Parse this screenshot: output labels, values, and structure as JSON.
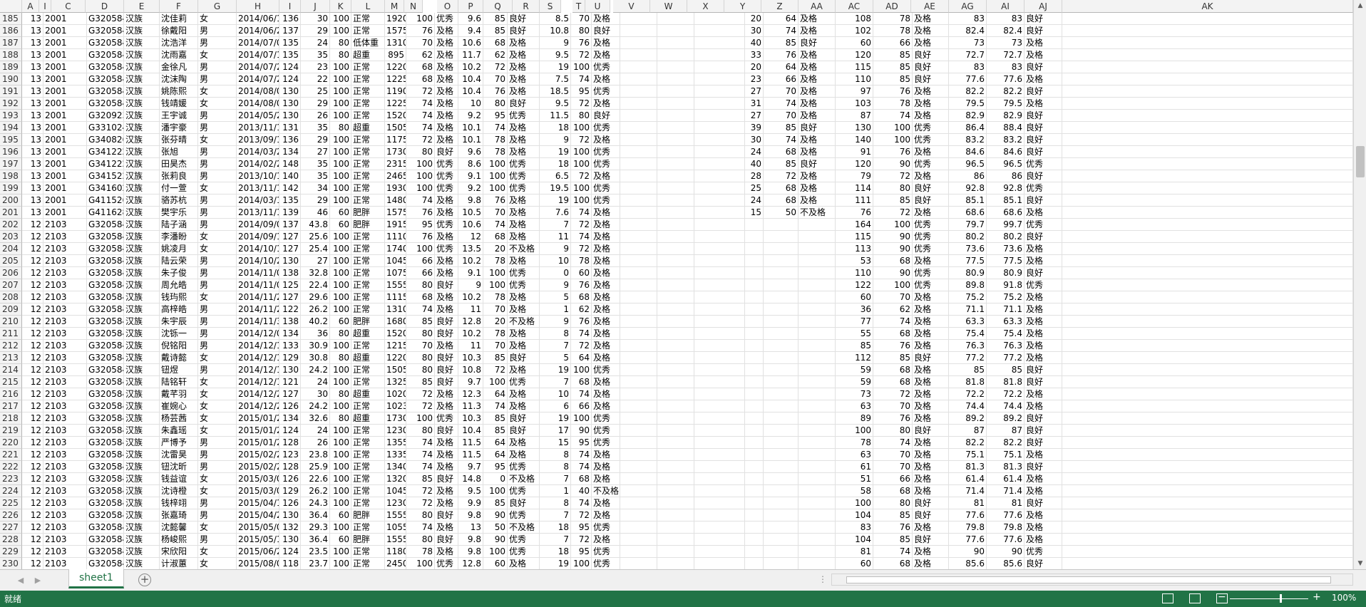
{
  "columns": [
    "A",
    "I",
    "C",
    "D",
    "E",
    "F",
    "G",
    "H",
    "I",
    "J",
    "K",
    "L",
    "M",
    "N",
    "O",
    "P",
    "Q",
    "R",
    "S",
    "T",
    "U",
    "V",
    "W",
    "X",
    "Y",
    "Z",
    "AA",
    "AC",
    "AD",
    "AE",
    "AG",
    "AI",
    "AJ",
    "AK"
  ],
  "rows": [
    [
      "185",
      "13",
      "2001",
      "G3205842",
      "汉族",
      "沈佳莉",
      "女",
      "2014/06/17",
      "136",
      "30",
      "100",
      "正常",
      "1920",
      "100",
      "优秀",
      "9.6",
      "85",
      "良好",
      "8.5",
      "70",
      "及格",
      "20",
      "64",
      "及格",
      "108",
      "78",
      "及格",
      "83",
      "83",
      "良好"
    ],
    [
      "186",
      "13",
      "2001",
      "G3205842",
      "汉族",
      "徐戴阳",
      "男",
      "2014/06/23",
      "137",
      "29",
      "100",
      "正常",
      "1575",
      "76",
      "及格",
      "9.4",
      "85",
      "良好",
      "10.8",
      "80",
      "良好",
      "30",
      "74",
      "及格",
      "102",
      "78",
      "及格",
      "82.4",
      "82.4",
      "良好"
    ],
    [
      "187",
      "13",
      "2001",
      "G3205842",
      "汉族",
      "沈浩洋",
      "男",
      "2014/07/06",
      "135",
      "24",
      "80",
      "低体重",
      "1310",
      "70",
      "及格",
      "10.6",
      "68",
      "及格",
      "9",
      "76",
      "及格",
      "40",
      "85",
      "良好",
      "60",
      "66",
      "及格",
      "73",
      "73",
      "及格"
    ],
    [
      "188",
      "13",
      "2001",
      "G3205842",
      "汉族",
      "沈雨嘉",
      "女",
      "2014/07/13",
      "135",
      "35",
      "80",
      "超重",
      "895",
      "62",
      "及格",
      "11.7",
      "62",
      "及格",
      "9.5",
      "72",
      "及格",
      "33",
      "76",
      "及格",
      "120",
      "85",
      "良好",
      "72.7",
      "72.7",
      "及格"
    ],
    [
      "189",
      "13",
      "2001",
      "G3205842",
      "汉族",
      "金徐凡",
      "男",
      "2014/07/22",
      "124",
      "23",
      "100",
      "正常",
      "1220",
      "68",
      "及格",
      "10.2",
      "72",
      "及格",
      "19",
      "100",
      "优秀",
      "20",
      "64",
      "及格",
      "115",
      "85",
      "良好",
      "83",
      "83",
      "良好"
    ],
    [
      "190",
      "13",
      "2001",
      "G3205842",
      "汉族",
      "沈沫陶",
      "男",
      "2014/07/25",
      "124",
      "22",
      "100",
      "正常",
      "1225",
      "68",
      "及格",
      "10.4",
      "70",
      "及格",
      "7.5",
      "74",
      "及格",
      "23",
      "66",
      "及格",
      "110",
      "85",
      "良好",
      "77.6",
      "77.6",
      "及格"
    ],
    [
      "191",
      "13",
      "2001",
      "G3205842",
      "汉族",
      "姚陈熙",
      "女",
      "2014/08/01",
      "130",
      "25",
      "100",
      "正常",
      "1190",
      "72",
      "及格",
      "10.4",
      "76",
      "及格",
      "18.5",
      "95",
      "优秀",
      "27",
      "70",
      "及格",
      "97",
      "76",
      "及格",
      "82.2",
      "82.2",
      "良好"
    ],
    [
      "192",
      "13",
      "2001",
      "G3205842",
      "汉族",
      "钱靖媛",
      "女",
      "2014/08/06",
      "130",
      "29",
      "100",
      "正常",
      "1225",
      "74",
      "及格",
      "10",
      "80",
      "良好",
      "9.5",
      "72",
      "及格",
      "31",
      "74",
      "及格",
      "103",
      "78",
      "及格",
      "79.5",
      "79.5",
      "及格"
    ],
    [
      "193",
      "13",
      "2001",
      "G3209232",
      "汉族",
      "王宇诚",
      "男",
      "2014/05/24",
      "130",
      "26",
      "100",
      "正常",
      "1520",
      "74",
      "及格",
      "9.2",
      "95",
      "优秀",
      "11.5",
      "80",
      "良好",
      "27",
      "70",
      "及格",
      "87",
      "74",
      "及格",
      "82.9",
      "82.9",
      "良好"
    ],
    [
      "194",
      "13",
      "2001",
      "G3310242",
      "汉族",
      "潘宇豪",
      "男",
      "2013/11/16",
      "131",
      "35",
      "80",
      "超重",
      "1505",
      "74",
      "及格",
      "10.1",
      "74",
      "及格",
      "18",
      "100",
      "优秀",
      "39",
      "85",
      "良好",
      "130",
      "100",
      "优秀",
      "86.4",
      "88.4",
      "良好"
    ],
    [
      "195",
      "13",
      "2001",
      "G3408262",
      "汉族",
      "张芬晴",
      "女",
      "2013/09/11",
      "136",
      "29",
      "100",
      "正常",
      "1175",
      "72",
      "及格",
      "10.1",
      "78",
      "及格",
      "9",
      "72",
      "及格",
      "30",
      "74",
      "及格",
      "140",
      "100",
      "优秀",
      "83.2",
      "83.2",
      "良好"
    ],
    [
      "196",
      "13",
      "2001",
      "G3412222",
      "汉族",
      "张旭",
      "男",
      "2014/03/22",
      "134",
      "27",
      "100",
      "正常",
      "1730",
      "80",
      "良好",
      "9.6",
      "78",
      "及格",
      "19",
      "100",
      "优秀",
      "24",
      "68",
      "及格",
      "91",
      "76",
      "及格",
      "84.6",
      "84.6",
      "良好"
    ],
    [
      "197",
      "13",
      "2001",
      "G3412222",
      "汉族",
      "田昊杰",
      "男",
      "2014/02/22",
      "148",
      "35",
      "100",
      "正常",
      "2315",
      "100",
      "优秀",
      "8.6",
      "100",
      "优秀",
      "18",
      "100",
      "优秀",
      "40",
      "85",
      "良好",
      "120",
      "90",
      "优秀",
      "96.5",
      "96.5",
      "优秀"
    ],
    [
      "198",
      "13",
      "2001",
      "G3415222",
      "汉族",
      "张莉良",
      "男",
      "2013/10/16",
      "140",
      "35",
      "100",
      "正常",
      "2465",
      "100",
      "优秀",
      "9.1",
      "100",
      "优秀",
      "6.5",
      "72",
      "及格",
      "28",
      "72",
      "及格",
      "79",
      "72",
      "及格",
      "86",
      "86",
      "良好"
    ],
    [
      "199",
      "13",
      "2001",
      "G3416022",
      "汉族",
      "付一萱",
      "女",
      "2013/11/19",
      "142",
      "34",
      "100",
      "正常",
      "1930",
      "100",
      "优秀",
      "9.2",
      "100",
      "优秀",
      "19.5",
      "100",
      "优秀",
      "25",
      "68",
      "及格",
      "114",
      "80",
      "良好",
      "92.8",
      "92.8",
      "优秀"
    ],
    [
      "200",
      "13",
      "2001",
      "G4115262",
      "汉族",
      "骆苏杭",
      "男",
      "2014/03/12",
      "135",
      "29",
      "100",
      "正常",
      "1480",
      "74",
      "及格",
      "9.8",
      "76",
      "及格",
      "19",
      "100",
      "优秀",
      "24",
      "68",
      "及格",
      "111",
      "85",
      "良好",
      "85.1",
      "85.1",
      "良好"
    ],
    [
      "201",
      "13",
      "2001",
      "G4116282",
      "汉族",
      "樊宇乐",
      "男",
      "2013/11/18",
      "139",
      "46",
      "60",
      "肥胖",
      "1575",
      "76",
      "及格",
      "10.5",
      "70",
      "及格",
      "7.6",
      "74",
      "及格",
      "15",
      "50",
      "不及格",
      "76",
      "72",
      "及格",
      "68.6",
      "68.6",
      "及格"
    ],
    [
      "202",
      "12",
      "2103",
      "G3205842",
      "汉族",
      "陆子涵",
      "男",
      "2014/09/03",
      "137",
      "43.8",
      "60",
      "肥胖",
      "1915",
      "95",
      "优秀",
      "10.6",
      "74",
      "及格",
      "7",
      "72",
      "及格",
      "",
      "",
      "",
      "164",
      "100",
      "优秀",
      "79.7",
      "99.7",
      "优秀"
    ],
    [
      "203",
      "12",
      "2103",
      "G3205842",
      "汉族",
      "李潘盼",
      "女",
      "2014/09/14",
      "127",
      "25.6",
      "100",
      "正常",
      "1110",
      "76",
      "及格",
      "12",
      "68",
      "及格",
      "11",
      "74",
      "及格",
      "",
      "",
      "",
      "115",
      "90",
      "优秀",
      "80.2",
      "80.2",
      "良好"
    ],
    [
      "204",
      "12",
      "2103",
      "G3205842",
      "汉族",
      "姚凌月",
      "女",
      "2014/10/13",
      "127",
      "25.4",
      "100",
      "正常",
      "1740",
      "100",
      "优秀",
      "13.5",
      "20",
      "不及格",
      "9",
      "72",
      "及格",
      "",
      "",
      "",
      "113",
      "90",
      "优秀",
      "73.6",
      "73.6",
      "及格"
    ],
    [
      "205",
      "12",
      "2103",
      "G3205842",
      "汉族",
      "陆云荣",
      "男",
      "2014/10/23",
      "130",
      "27",
      "100",
      "正常",
      "1045",
      "66",
      "及格",
      "10.2",
      "78",
      "及格",
      "10",
      "78",
      "及格",
      "",
      "",
      "",
      "53",
      "68",
      "及格",
      "77.5",
      "77.5",
      "及格"
    ],
    [
      "206",
      "12",
      "2103",
      "G3205842",
      "汉族",
      "朱子俊",
      "男",
      "2014/11/08",
      "138",
      "32.8",
      "100",
      "正常",
      "1075",
      "66",
      "及格",
      "9.1",
      "100",
      "优秀",
      "0",
      "60",
      "及格",
      "",
      "",
      "",
      "110",
      "90",
      "优秀",
      "80.9",
      "80.9",
      "良好"
    ],
    [
      "207",
      "12",
      "2103",
      "G3205842",
      "汉族",
      "周允皓",
      "男",
      "2014/11/09",
      "125",
      "22.4",
      "100",
      "正常",
      "1555",
      "80",
      "良好",
      "9",
      "100",
      "优秀",
      "9",
      "76",
      "及格",
      "",
      "",
      "",
      "122",
      "100",
      "优秀",
      "89.8",
      "91.8",
      "优秀"
    ],
    [
      "208",
      "12",
      "2103",
      "G3205842",
      "汉族",
      "钱玙熙",
      "女",
      "2014/11/26",
      "127",
      "29.6",
      "100",
      "正常",
      "1115",
      "68",
      "及格",
      "10.2",
      "78",
      "及格",
      "5",
      "68",
      "及格",
      "",
      "",
      "",
      "60",
      "70",
      "及格",
      "75.2",
      "75.2",
      "及格"
    ],
    [
      "209",
      "12",
      "2103",
      "G3205842",
      "汉族",
      "高梓皓",
      "男",
      "2014/11/29",
      "122",
      "26.2",
      "100",
      "正常",
      "1310",
      "74",
      "及格",
      "11",
      "70",
      "及格",
      "1",
      "62",
      "及格",
      "",
      "",
      "",
      "36",
      "62",
      "及格",
      "71.1",
      "71.1",
      "及格"
    ],
    [
      "210",
      "12",
      "2103",
      "G3205842",
      "汉族",
      "朱宇辰",
      "男",
      "2014/11/30",
      "138",
      "40.2",
      "60",
      "肥胖",
      "1680",
      "85",
      "良好",
      "12.8",
      "20",
      "不及格",
      "9",
      "76",
      "及格",
      "",
      "",
      "",
      "77",
      "74",
      "及格",
      "63.3",
      "63.3",
      "及格"
    ],
    [
      "211",
      "12",
      "2103",
      "G3205842",
      "汉族",
      "沈铄一",
      "男",
      "2014/12/09",
      "134",
      "36",
      "80",
      "超重",
      "1520",
      "80",
      "良好",
      "10.2",
      "78",
      "及格",
      "8",
      "74",
      "及格",
      "",
      "",
      "",
      "55",
      "68",
      "及格",
      "75.4",
      "75.4",
      "及格"
    ],
    [
      "212",
      "12",
      "2103",
      "G3205842",
      "汉族",
      "倪铭阳",
      "男",
      "2014/12/10",
      "133",
      "30.9",
      "100",
      "正常",
      "1215",
      "70",
      "及格",
      "11",
      "70",
      "及格",
      "7",
      "72",
      "及格",
      "",
      "",
      "",
      "85",
      "76",
      "及格",
      "76.3",
      "76.3",
      "及格"
    ],
    [
      "213",
      "12",
      "2103",
      "G3205842",
      "汉族",
      "戴诗懿",
      "女",
      "2014/12/11",
      "129",
      "30.8",
      "80",
      "超重",
      "1220",
      "80",
      "良好",
      "10.3",
      "85",
      "良好",
      "5",
      "64",
      "及格",
      "",
      "",
      "",
      "112",
      "85",
      "良好",
      "77.2",
      "77.2",
      "及格"
    ],
    [
      "214",
      "12",
      "2103",
      "G3205842",
      "汉族",
      "钮煜",
      "男",
      "2014/12/18",
      "130",
      "24.2",
      "100",
      "正常",
      "1505",
      "80",
      "良好",
      "10.8",
      "72",
      "及格",
      "19",
      "100",
      "优秀",
      "",
      "",
      "",
      "59",
      "68",
      "及格",
      "85",
      "85",
      "良好"
    ],
    [
      "215",
      "12",
      "2103",
      "G3205842",
      "汉族",
      "陆铭轩",
      "女",
      "2014/12/19",
      "121",
      "24",
      "100",
      "正常",
      "1325",
      "85",
      "良好",
      "9.7",
      "100",
      "优秀",
      "7",
      "68",
      "及格",
      "",
      "",
      "",
      "59",
      "68",
      "及格",
      "81.8",
      "81.8",
      "良好"
    ],
    [
      "216",
      "12",
      "2103",
      "G3205842",
      "汉族",
      "戴芊羽",
      "女",
      "2014/12/25",
      "127",
      "30",
      "80",
      "超重",
      "1020",
      "72",
      "及格",
      "12.3",
      "64",
      "及格",
      "10",
      "74",
      "及格",
      "",
      "",
      "",
      "73",
      "72",
      "及格",
      "72.2",
      "72.2",
      "及格"
    ],
    [
      "217",
      "12",
      "2103",
      "G3205842",
      "汉族",
      "崔婉心",
      "女",
      "2014/12/26",
      "126",
      "24.2",
      "100",
      "正常",
      "1023",
      "72",
      "及格",
      "11.3",
      "74",
      "及格",
      "6",
      "66",
      "及格",
      "",
      "",
      "",
      "63",
      "70",
      "及格",
      "74.4",
      "74.4",
      "及格"
    ],
    [
      "218",
      "12",
      "2103",
      "G3205842",
      "汉族",
      "杨芸茜",
      "女",
      "2015/01/25",
      "134",
      "32.6",
      "80",
      "超重",
      "1730",
      "100",
      "优秀",
      "10.3",
      "85",
      "良好",
      "19",
      "100",
      "优秀",
      "",
      "",
      "",
      "89",
      "76",
      "及格",
      "89.2",
      "89.2",
      "良好"
    ],
    [
      "219",
      "12",
      "2103",
      "G3205842",
      "汉族",
      "朱鑫瑶",
      "女",
      "2015/01/27",
      "124",
      "24",
      "100",
      "正常",
      "1230",
      "80",
      "良好",
      "10.4",
      "85",
      "良好",
      "17",
      "90",
      "优秀",
      "",
      "",
      "",
      "100",
      "80",
      "良好",
      "87",
      "87",
      "良好"
    ],
    [
      "220",
      "12",
      "2103",
      "G3205842",
      "汉族",
      "严博予",
      "男",
      "2015/01/28",
      "128",
      "26",
      "100",
      "正常",
      "1355",
      "74",
      "及格",
      "11.5",
      "64",
      "及格",
      "15",
      "95",
      "优秀",
      "",
      "",
      "",
      "78",
      "74",
      "及格",
      "82.2",
      "82.2",
      "良好"
    ],
    [
      "221",
      "12",
      "2103",
      "G3205842",
      "汉族",
      "沈雷昊",
      "男",
      "2015/02/21",
      "123",
      "23.8",
      "100",
      "正常",
      "1335",
      "74",
      "及格",
      "11.5",
      "64",
      "及格",
      "8",
      "74",
      "及格",
      "",
      "",
      "",
      "63",
      "70",
      "及格",
      "75.1",
      "75.1",
      "及格"
    ],
    [
      "222",
      "12",
      "2103",
      "G3205842",
      "汉族",
      "钮沈昕",
      "男",
      "2015/02/23",
      "128",
      "25.9",
      "100",
      "正常",
      "1340",
      "74",
      "及格",
      "9.7",
      "95",
      "优秀",
      "8",
      "74",
      "及格",
      "",
      "",
      "",
      "61",
      "70",
      "及格",
      "81.3",
      "81.3",
      "良好"
    ],
    [
      "223",
      "12",
      "2103",
      "G3205842",
      "汉族",
      "钱益谊",
      "女",
      "2015/03/02",
      "126",
      "22.6",
      "100",
      "正常",
      "1320",
      "85",
      "良好",
      "14.8",
      "0",
      "不及格",
      "7",
      "68",
      "及格",
      "",
      "",
      "",
      "51",
      "66",
      "及格",
      "61.4",
      "61.4",
      "及格"
    ],
    [
      "224",
      "12",
      "2103",
      "G3205842",
      "汉族",
      "沈诗橙",
      "女",
      "2015/03/08",
      "129",
      "26.2",
      "100",
      "正常",
      "1045",
      "72",
      "及格",
      "9.5",
      "100",
      "优秀",
      "1",
      "40",
      "不及格",
      "",
      "",
      "",
      "58",
      "68",
      "及格",
      "71.4",
      "71.4",
      "及格"
    ],
    [
      "225",
      "12",
      "2103",
      "G3205842",
      "汉族",
      "钱梓翊",
      "男",
      "2015/04/10",
      "126",
      "24.3",
      "100",
      "正常",
      "1230",
      "72",
      "及格",
      "9.9",
      "85",
      "良好",
      "8",
      "74",
      "及格",
      "",
      "",
      "",
      "100",
      "80",
      "良好",
      "81",
      "81",
      "良好"
    ],
    [
      "226",
      "12",
      "2103",
      "G3205842",
      "汉族",
      "张嘉琦",
      "男",
      "2015/04/21",
      "130",
      "36.4",
      "60",
      "肥胖",
      "1555",
      "80",
      "良好",
      "9.8",
      "90",
      "优秀",
      "7",
      "72",
      "及格",
      "",
      "",
      "",
      "104",
      "85",
      "良好",
      "77.6",
      "77.6",
      "及格"
    ],
    [
      "227",
      "12",
      "2103",
      "G3205842",
      "汉族",
      "沈懿馨",
      "女",
      "2015/05/09",
      "132",
      "29.3",
      "100",
      "正常",
      "1055",
      "74",
      "及格",
      "13",
      "50",
      "不及格",
      "18",
      "95",
      "优秀",
      "",
      "",
      "",
      "83",
      "76",
      "及格",
      "79.8",
      "79.8",
      "及格"
    ],
    [
      "228",
      "12",
      "2103",
      "G3205842",
      "汉族",
      "杨峻熙",
      "男",
      "2015/05/19",
      "130",
      "36.4",
      "60",
      "肥胖",
      "1555",
      "80",
      "良好",
      "9.8",
      "90",
      "优秀",
      "7",
      "72",
      "及格",
      "",
      "",
      "",
      "104",
      "85",
      "良好",
      "77.6",
      "77.6",
      "及格"
    ],
    [
      "229",
      "12",
      "2103",
      "G3205842",
      "汉族",
      "宋欣阳",
      "女",
      "2015/06/21",
      "124",
      "23.5",
      "100",
      "正常",
      "1180",
      "78",
      "及格",
      "9.8",
      "100",
      "优秀",
      "18",
      "95",
      "优秀",
      "",
      "",
      "",
      "81",
      "74",
      "及格",
      "90",
      "90",
      "优秀"
    ],
    [
      "230",
      "12",
      "2103",
      "G3205842",
      "汉族",
      "计淑蕙",
      "女",
      "2015/08/03",
      "118",
      "23.7",
      "100",
      "正常",
      "2450",
      "100",
      "优秀",
      "12.8",
      "60",
      "及格",
      "19",
      "100",
      "优秀",
      "",
      "",
      "",
      "60",
      "68",
      "及格",
      "85.6",
      "85.6",
      "良好"
    ]
  ],
  "sheet_tab": "sheet1",
  "status": {
    "ready": "就绪",
    "zoom": "100%"
  },
  "icons": {
    "normal_view": "normal-view-icon",
    "page_layout": "page-layout-icon",
    "page_break": "page-break-preview-icon"
  },
  "colors": {
    "accent": "#217346"
  }
}
